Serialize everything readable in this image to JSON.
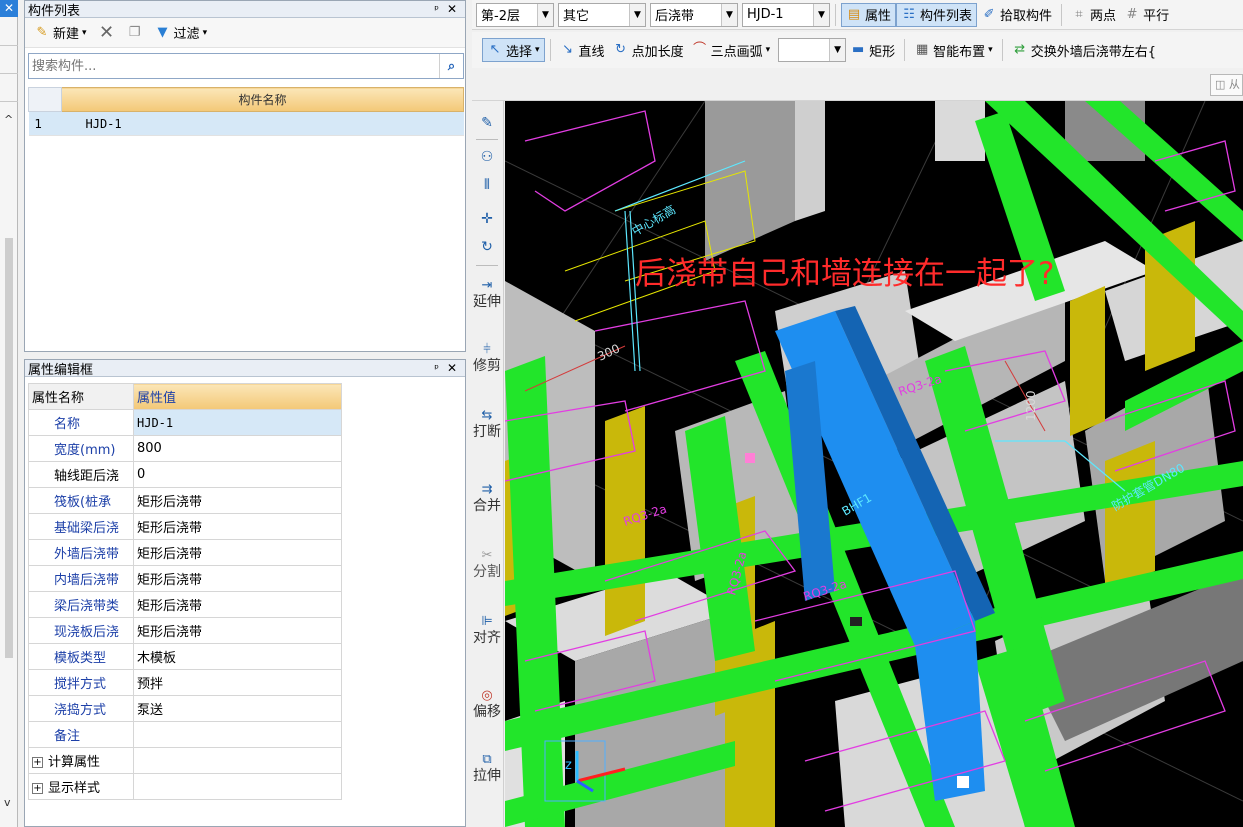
{
  "component_list": {
    "title": "构件列表",
    "toolbar": {
      "new_label": "新建",
      "filter_label": "过滤"
    },
    "search": {
      "placeholder": "搜索构件...",
      "value": ""
    },
    "table": {
      "header": "构件名称",
      "rows": [
        {
          "index": "1",
          "name": "HJD-1"
        }
      ]
    }
  },
  "property_panel": {
    "title": "属性编辑框",
    "header": {
      "name_col": "属性名称",
      "value_col": "属性值"
    },
    "rows": [
      {
        "key": "名称",
        "value": "HJD-1"
      },
      {
        "key": "宽度(mm)",
        "value": "800"
      },
      {
        "key": "轴线距后浇",
        "value": "0"
      },
      {
        "key": "筏板(桩承",
        "value": "矩形后浇带"
      },
      {
        "key": "基础梁后浇",
        "value": "矩形后浇带"
      },
      {
        "key": "外墙后浇带",
        "value": "矩形后浇带"
      },
      {
        "key": "内墙后浇带",
        "value": "矩形后浇带"
      },
      {
        "key": "梁后浇带类",
        "value": "矩形后浇带"
      },
      {
        "key": "现浇板后浇",
        "value": "矩形后浇带"
      },
      {
        "key": "模板类型",
        "value": "木模板"
      },
      {
        "key": "搅拌方式",
        "value": "预拌"
      },
      {
        "key": "浇捣方式",
        "value": "泵送"
      },
      {
        "key": "备注",
        "value": ""
      },
      {
        "key": "计算属性",
        "value": ""
      },
      {
        "key": "显示样式",
        "value": ""
      }
    ]
  },
  "toolbar_top": {
    "floor": "第-2层",
    "category": "其它",
    "type": "后浇带",
    "component": "HJD-1",
    "property_label": "属性",
    "component_list_label": "构件列表",
    "pick_label": "拾取构件",
    "two_point_label": "两点",
    "parallel_label": "平行"
  },
  "toolbar_draw": {
    "select_label": "选择",
    "line_label": "直线",
    "point_length_label": "点加长度",
    "three_point_arc_label": "三点画弧",
    "rect_label": "矩形",
    "smart_layout_label": "智能布置",
    "swap_label": "交换外墙后浇带左右{"
  },
  "toolbar_mini": {
    "label": "从"
  },
  "vertical_tools": [
    "延伸",
    "修剪",
    "打断",
    "合并",
    "分割",
    "对齐",
    "偏移",
    "拉伸"
  ],
  "canvas": {
    "annotation": "后浇带自己和墙连接在一起了?",
    "labels": [
      "RQ3-2a",
      "RQ3-2a",
      "RQ3-2a",
      "RQ3-2a",
      "BHF1",
      "中心标高",
      "防护套管DN80",
      "1200",
      "300"
    ],
    "colors": {
      "background": "#000000",
      "beam": "#22e52a",
      "band": "#1e8ef0",
      "column": "#c9b80a",
      "wall": "#b9b9b9",
      "annotation": "#ff2b2b"
    }
  }
}
